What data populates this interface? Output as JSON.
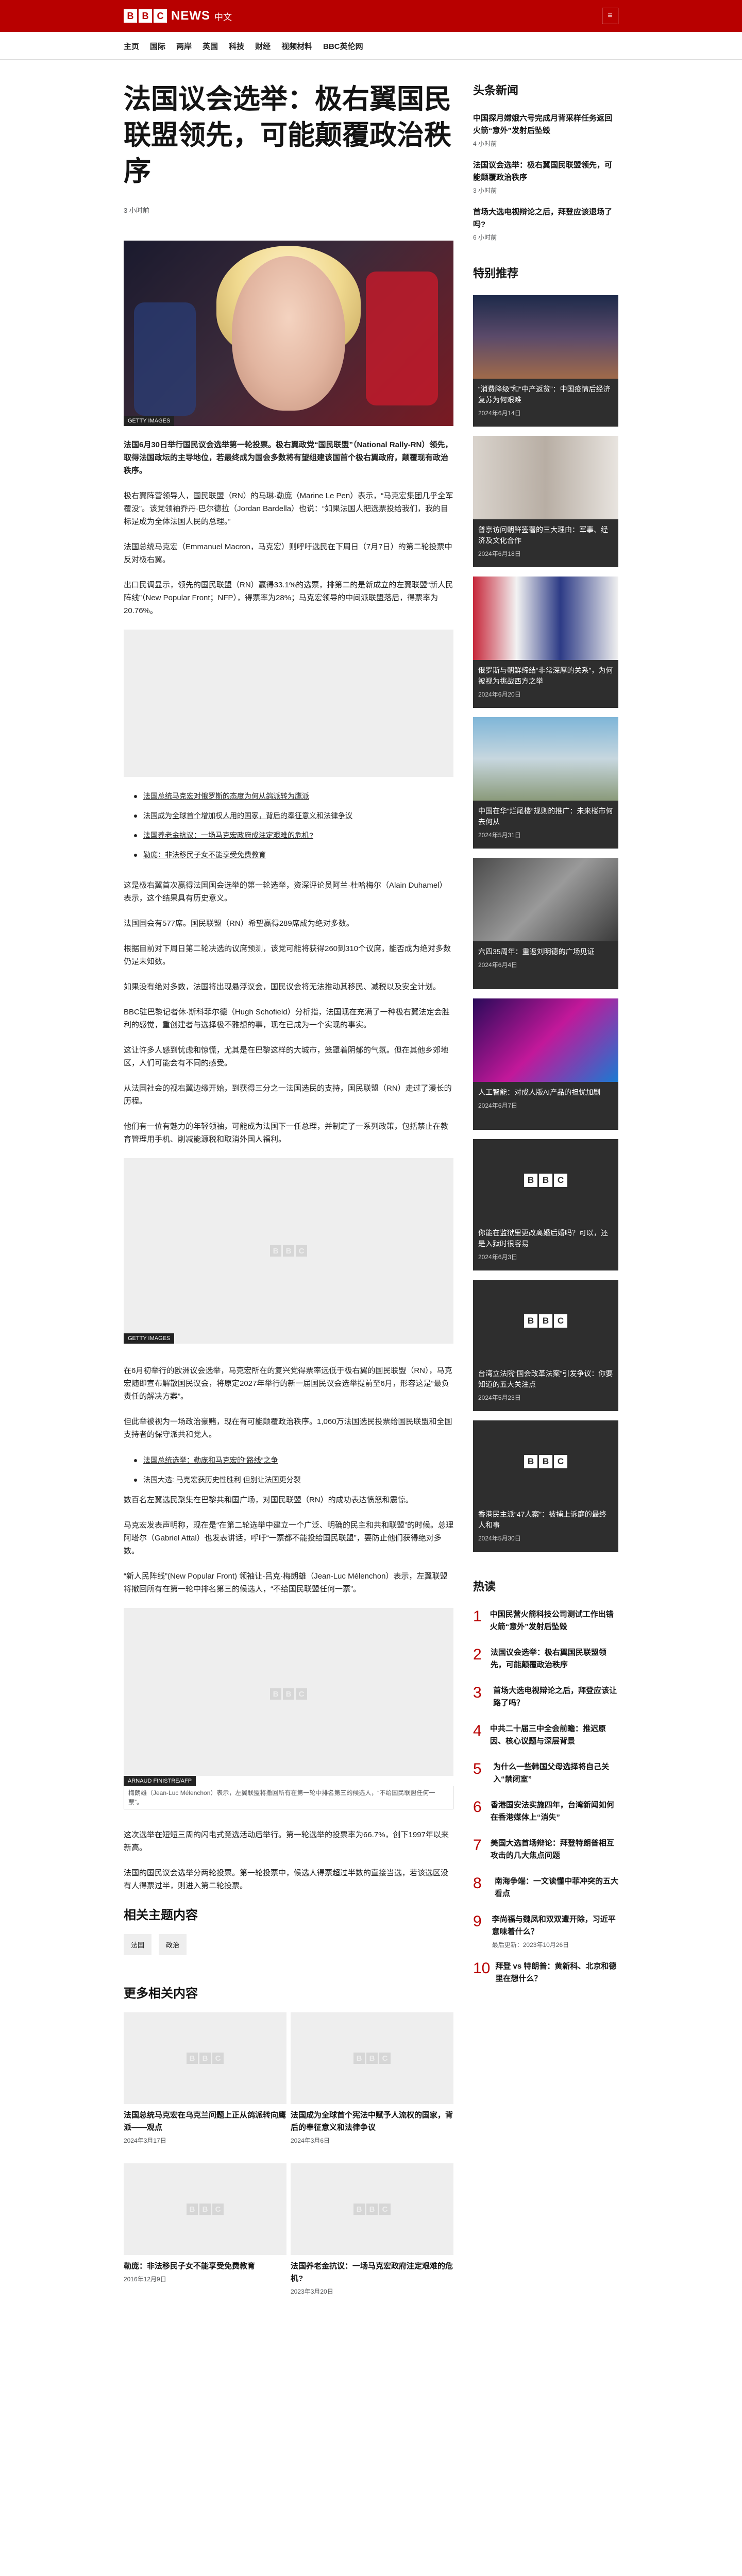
{
  "brand": {
    "blocks": [
      "B",
      "B",
      "C"
    ],
    "news": "NEWS",
    "lang": "中文",
    "menu_icon": "≡"
  },
  "nav": [
    "主页",
    "国际",
    "两岸",
    "英国",
    "科技",
    "财经",
    "视频材料",
    "BBC英伦网"
  ],
  "article": {
    "title": "法国议会选举：极右翼国民联盟领先，可能颠覆政治秩序",
    "time": "3 小时前",
    "hero_caption": "GETTY IMAGES",
    "lead": "法国6月30日举行国民议会选举第一轮投票。极右翼政党“国民联盟”（National Rally-RN）领先，取得法国政坛的主导地位，若最终成为国会多数将有望组建该国首个极右翼政府，颠覆现有政治秩序。",
    "paras1": [
      "极右翼阵营领导人，国民联盟（RN）的马琳·勒庞（Marine Le Pen）表示，“马克宏集团几乎全军覆没”。该党领袖乔丹·巴尔德拉（Jordan Bardella）也说：“如果法国人把选票投给我们，我的目标是成为全体法国人民的总理。”",
      "法国总统马克宏（Emmanuel Macron，马克宏）则呼吁选民在下周日（7月7日）的第二轮投票中反对极右翼。",
      "出口民调显示，领先的国民联盟（RN）赢得33.1%的选票，排第二的是新成立的左翼联盟“新人民阵线”（New Popular Front；NFP），得票率为28%；马克宏领导的中间派联盟落后，得票率为20.76%。"
    ],
    "links1": [
      "法国总统马克宏对俄罗斯的态度为何从鸽派转为鹰派",
      "法国成为全球首个增加权人用的国家，背后的奉征意义和法律争议",
      "法国养老金抗议：一场马克宏政府成注定艰难的危机?",
      "勒庞：非法移民子女不能享受免费教育"
    ],
    "paras2": [
      "这是极右翼首次赢得法国国会选举的第一轮选举，资深评论员阿兰·杜哈梅尔（Alain Duhamel）表示，这个结果具有历史意义。",
      "法国国会有577席。国民联盟（RN）希望赢得289席成为绝对多数。",
      "根据目前对下周日第二轮决选的议席预测，该党可能将获得260到310个议席，能否成为绝对多数仍是未知数。",
      "如果没有绝对多数，法国将出现悬浮议会，国民议会将无法推动其移民、减税以及安全计划。",
      "BBC驻巴黎记者休·斯科菲尔德（Hugh Schofield）分析指，法国现在充满了一种极右翼法定会胜利的感觉，重创建者与选择极不雅想的事，现在已成为一个实现的事实。",
      "这让许多人感到忧虑和惊慌，尤其是在巴黎这样的大城市，笼罩着阴郁的气氛。但在其他乡郊地区，人们可能会有不同的感受。",
      "从法国社会的视右翼边缘开始，到获得三分之一法国选民的支持，国民联盟（RN）走过了漫长的历程。",
      "他们有一位有魅力的年轻领袖，可能成为法国下一任总理，并制定了一系列政策，包括禁止在教育管理用手机、削减能源税和取消外国人福利。"
    ],
    "img2_caption": "GETTY IMAGES",
    "paras3": [
      "在6月初举行的欧洲议会选举，马克宏所在的复兴党得票率远低于极右翼的国民联盟（RN），马克宏随即宣布解散国民议会，将原定2027年举行的新一届国民议会选举提前至6月，形容这是“最负责任的解决方案”。",
      "但此举被视为一场政治豪赌，现在有可能颠覆政治秩序。1,060万法国选民投票给国民联盟和全国支持者的保守派共和党人。"
    ],
    "links2": [
      "法国总统选举：勒庞和马克宏的“路线”之争",
      "法国大选: 马克宏获历史性胜利 但别让法国更分裂"
    ],
    "paras4": [
      "数百名左翼选民聚集在巴黎共和国广场，对国民联盟（RN）的成功表达愤怒和震惊。",
      "马克宏发表声明称，现在是“在第二轮选举中建立一个广泛、明确的民主和共和联盟”的时候。总理阿塔尔（Gabriel Attal）也发表讲话，呼吁“一票都不能投给国民联盟”，要防止他们获得绝对多数。",
      "“新人民阵线”(New Popular Front) 领袖让-吕克·梅朗雄（Jean-Luc Mélenchon）表示，左翼联盟将撤回所有在第一轮中排名第三的候选人，“不给国民联盟任何一票”。"
    ],
    "img3_caption_tag": "ARNAUD FINISTRE/AFP",
    "img3_caption_text": "梅朗雄（Jean-Luc Mélenchon）表示，左翼联盟将撤回所有在第一轮中排名第三的候选人，“不给国民联盟任何一票”。",
    "paras5": [
      "这次选举在短短三周的闪电式竞选活动后举行。第一轮选举的投票率为66.7%，创下1997年以来新高。",
      "法国的国民议会选举分两轮投票。第一轮投票中，候选人得票超过半数的直接当选，若该选区没有人得票过半，则进入第二轮投票。"
    ]
  },
  "related": {
    "title": "相关主题内容",
    "topics": [
      "法国",
      "政治"
    ]
  },
  "more": {
    "title": "更多相关内容",
    "cards": [
      {
        "title": "法国总统马克宏在乌克兰问题上正从鸽派转向鹰派——观点",
        "date": "2024年3月17日"
      },
      {
        "title": "法国成为全球首个宪法中赋予人流权的国家，背后的奉征意义和法律争议",
        "date": "2024年3月6日"
      },
      {
        "title": "勒庞：非法移民子女不能享受免费教育",
        "date": "2016年12月9日"
      },
      {
        "title": "法国养老金抗议：一场马克宏政府注定艰难的危机?",
        "date": "2023年3月20日"
      }
    ]
  },
  "side": {
    "headlines_title": "头条新闻",
    "headlines": [
      {
        "t": "中国探月嫦娥六号完成月背采样任务返回 火箭“意外”发射后坠毁",
        "d": "4 小时前"
      },
      {
        "t": "法国议会选举：极右翼国民联盟领先，可能颠覆政治秩序",
        "d": "3 小时前"
      },
      {
        "t": "首场大选电视辩论之后，拜登应该退场了吗?",
        "d": "6 小时前"
      }
    ],
    "featured_title": "特别推荐",
    "featured": [
      {
        "cap": "“消费降级”和“中产返贫”：中国疫情后经济复苏为何艰难 ",
        "date": "2024年6月14日"
      },
      {
        "cap": "普京访问朝鲜签署的三大理由：军事、经济及文化合作",
        "date": "2024年6月18日"
      },
      {
        "cap": "俄罗斯与朝鲜缔结“非常深厚的关系”，为何被视为挑战西方之举",
        "date": "2024年6月20日"
      },
      {
        "cap": "中国在华“烂尾楼”规则的推广：未来楼市何去何从",
        "date": "2024年5月31日"
      },
      {
        "cap": "六四35周年：重返刘明德的广场见证",
        "date": "2024年6月4日"
      },
      {
        "cap": "人工智能：对成人版AI产品的担忧加剧",
        "date": "2024年6月7日"
      },
      {
        "cap": "你能在监狱里更改离婚后婚吗？可以，还是入狱时很容易",
        "date": "2024年6月3日"
      },
      {
        "cap": "台湾立法院“国会改革法案”引发争议：你要知道的五大关注点",
        "date": "2024年5月23日"
      },
      {
        "cap": "香港民主派“47人案”：被捕上诉庭的最终人和事",
        "date": "2024年5月30日"
      }
    ],
    "popular_title": "热读",
    "popular": [
      {
        "n": "1",
        "t": "中国民营火箭科技公司测试工作出错 火箭“意外”发射后坠毁",
        "d": ""
      },
      {
        "n": "2",
        "t": "法国议会选举：极右翼国民联盟领先，可能颠覆政治秩序",
        "d": ""
      },
      {
        "n": "3",
        "t": "首场大选电视辩论之后，拜登应该让路了吗？",
        "d": ""
      },
      {
        "n": "4",
        "t": "中共二十届三中全会前瞻：推迟原因、核心议题与深层背景",
        "d": ""
      },
      {
        "n": "5",
        "t": "为什么一些韩国父母选择将自己关入“禁闭室”",
        "d": ""
      },
      {
        "n": "6",
        "t": "香港国安法实施四年，台湾新闻如何在香港媒体上“消失”",
        "d": ""
      },
      {
        "n": "7",
        "t": "美国大选首场辩论：拜登特朗普相互攻击的几大焦点问题",
        "d": ""
      },
      {
        "n": "8",
        "t": "南海争端：一文读懂中菲冲突的五大看点",
        "d": ""
      },
      {
        "n": "9",
        "t": "李尚福与魏凤和双双遭开除，习近平意味着什么？",
        "d": "最后更新：2023年10月26日"
      },
      {
        "n": "10",
        "t": "拜登 vs 特朗普：黄新科、北京和德里在想什么？",
        "d": ""
      }
    ]
  },
  "bbc_ph": [
    "B",
    "B",
    "C"
  ]
}
